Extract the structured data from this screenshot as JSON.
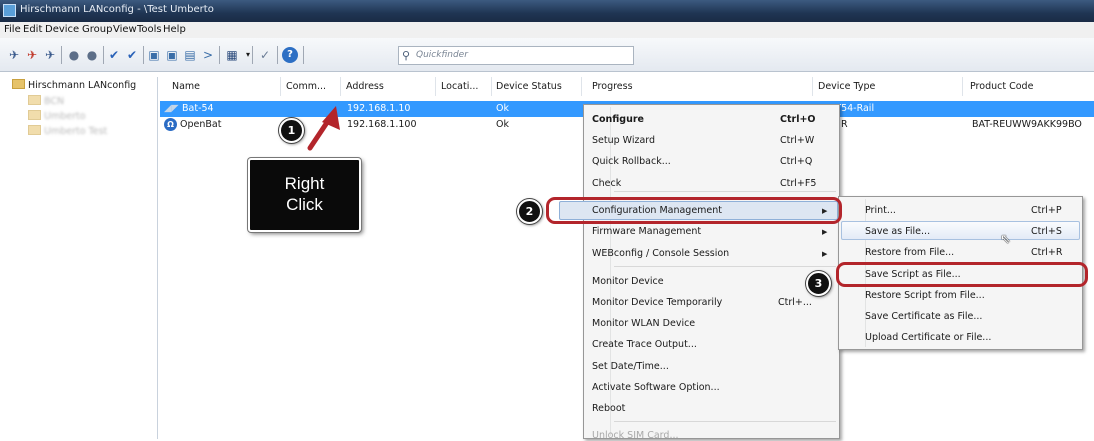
{
  "window": {
    "title": "Hirschmann LANconfig - \\Test Umberto"
  },
  "menubar": [
    "File",
    "Edit",
    "Device",
    "Group",
    "View",
    "Tools",
    "Help"
  ],
  "toolbar": {
    "quickfinder_placeholder": "Quickfinder"
  },
  "tree": {
    "root_label": "Hirschmann LANconfig",
    "child_label": "BCN",
    "child_blur_1": "Umberto",
    "child_blur_2": "Umberto Test"
  },
  "table": {
    "columns": [
      "Name",
      "Comm...",
      "Address",
      "Locati...",
      "Device Status",
      "Progress",
      "Device Type",
      "Product Code"
    ],
    "rows": [
      {
        "name": "Bat-54",
        "address": "192.168.1.10",
        "status": "Ok",
        "device_type": "BAT54-Rail",
        "product_code": ""
      },
      {
        "name": "OpenBat",
        "address": "192.168.1.100",
        "status": "Ok",
        "device_type": "...R",
        "product_code": "BAT-REUWW9AKK99BO"
      }
    ]
  },
  "context_menu": {
    "items": [
      {
        "label": "Configure",
        "shortcut": "Ctrl+O"
      },
      {
        "label": "Setup Wizard",
        "shortcut": "Ctrl+W"
      },
      {
        "label": "Quick Rollback...",
        "shortcut": "Ctrl+Q"
      },
      {
        "label": "Check",
        "shortcut": "Ctrl+F5"
      },
      {
        "label": "Configuration Management",
        "shortcut": ""
      },
      {
        "label": "Firmware Management",
        "shortcut": ""
      },
      {
        "label": "WEBconfig / Console Session",
        "shortcut": ""
      },
      {
        "label": "Monitor Device",
        "shortcut": ""
      },
      {
        "label": "Monitor Device Temporarily",
        "shortcut": "Ctrl+..."
      },
      {
        "label": "Monitor WLAN Device",
        "shortcut": ""
      },
      {
        "label": "Create Trace Output...",
        "shortcut": ""
      },
      {
        "label": "Set Date/Time...",
        "shortcut": ""
      },
      {
        "label": "Activate Software Option...",
        "shortcut": ""
      },
      {
        "label": "Reboot",
        "shortcut": ""
      },
      {
        "label": "Unlock SIM Card...",
        "shortcut": ""
      }
    ]
  },
  "submenu": {
    "items": [
      {
        "label": "Print...",
        "shortcut": "Ctrl+P"
      },
      {
        "label": "Save as File...",
        "shortcut": "Ctrl+S"
      },
      {
        "label": "Restore from File...",
        "shortcut": "Ctrl+R"
      },
      {
        "label": "Save Script as File...",
        "shortcut": ""
      },
      {
        "label": "Restore Script from File...",
        "shortcut": ""
      },
      {
        "label": "Save Certificate as File...",
        "shortcut": ""
      },
      {
        "label": "Upload Certificate or File...",
        "shortcut": ""
      }
    ]
  },
  "annotations": {
    "step1": "1",
    "step2": "2",
    "step3": "3",
    "callout_line1": "Right",
    "callout_line2": "Click",
    "ring_color": "#b3252b"
  }
}
